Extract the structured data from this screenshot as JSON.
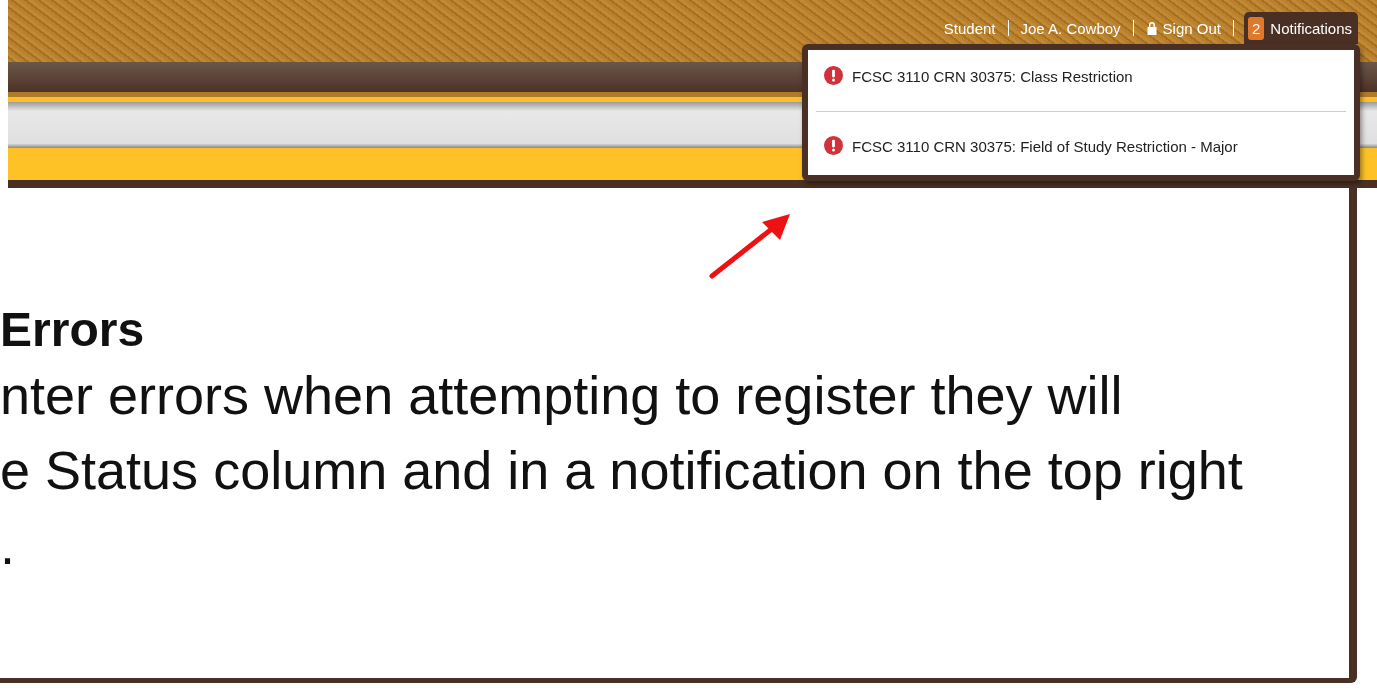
{
  "header_links": [
    {
      "label": "Student",
      "kind": "text"
    },
    {
      "label": "Joe A. Cowboy",
      "kind": "text"
    },
    {
      "label": "Sign Out",
      "kind": "signout"
    }
  ],
  "notifications": {
    "count": "2",
    "label": "Notifications",
    "expanded": true,
    "items": [
      {
        "text": "FCSC 3110 CRN 30375: Class Restriction",
        "kind": "error"
      },
      {
        "text": "FCSC 3110 CRN 30375: Field of Study Restriction - Major",
        "kind": "error"
      }
    ]
  },
  "content": {
    "heading": "Errors",
    "lines": [
      "nter errors when attempting to register they will",
      "e Status column and in a notification on the top right",
      "."
    ]
  }
}
